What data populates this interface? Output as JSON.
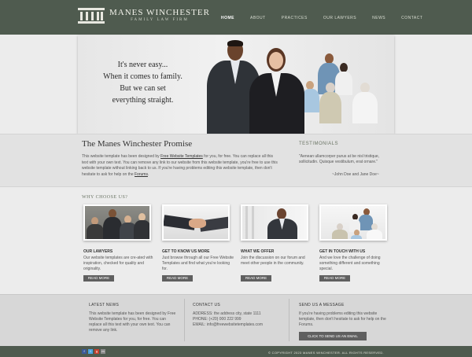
{
  "header": {
    "logo_title": "MANES WINCHESTER",
    "logo_subtitle": "FAMILY LAW FIRM",
    "nav": [
      "HOME",
      "ABOUT",
      "PRACTICES",
      "OUR LAWYERS",
      "NEWS",
      "CONTACT"
    ]
  },
  "hero": {
    "lines": [
      "It's never easy...",
      "When it comes to family.",
      "But we can set",
      "everything straight."
    ]
  },
  "promise": {
    "title": "The Manes Winchester Promise",
    "text_1": "This website template has been designed by ",
    "link_1": "Free Website Templates",
    "text_2": " for you, for free. You can replace all this text with your own text. You can remove any link to our website from this website template, you're free to use this website template without linking back to us. If you're having problems editing this website template, then don't hesitate to ask for help on the ",
    "link_2": "Forums",
    "text_3": "."
  },
  "testimonials": {
    "title": "TESTIMONIALS",
    "quote": "\"Aenean ullamcorper purus at be nisl tristique, sollicitudin. Quisque vestibulum, erat ornare.\"",
    "author": "~John Doe and Jane Doe~"
  },
  "why": {
    "title": "WHY CHOOSE US?",
    "cards": [
      {
        "title": "OUR LAWYERS",
        "text": "Our website templates are cre-ated with inspiration, checked for quality and originality.",
        "button": "READ MORE"
      },
      {
        "title": "GET TO KNOW US MORE",
        "text": "Just browse through all our Free Website Templates and find what you're looking for.",
        "button": "READ MORE"
      },
      {
        "title": "WHAT WE OFFER",
        "text": "Join the discussion on our forum and meet other people in the community.",
        "button": "READ MORE"
      },
      {
        "title": "GET IN TOUCH WITH US",
        "text": "And we love the challenge of doing something different and something special.",
        "button": "READ MORE"
      }
    ]
  },
  "footer": {
    "news_title": "LATEST NEWS",
    "news_text": "This website template has been designed by Free Website Templates for you, for free. You can replace all this text with your own text. You can remove any link.",
    "contact_title": "CONTACT US",
    "contact_address": "ADDRESS: the address city, state 1111",
    "contact_phone": "PHONE: (+20) 000 222 999",
    "contact_email": "EMAIL: info@freewebsitetemplates.com",
    "message_title": "SEND US A MESSAGE",
    "message_text": "If you're having problems editing this website template, then don't hesitate to ask for help on the Forums.",
    "email_button": "CLICK TO SEND US AN EMAIL",
    "social": [
      "f",
      "t",
      "g",
      "m"
    ],
    "copyright": "© COPYRIGHT 2023 MANES WINCHESTER. ALL RIGHTS RESERVED."
  },
  "colors": {
    "header_bg": "#4f5b4f",
    "accent_green": "#6a7464",
    "button_bg": "#5f5f5f"
  }
}
